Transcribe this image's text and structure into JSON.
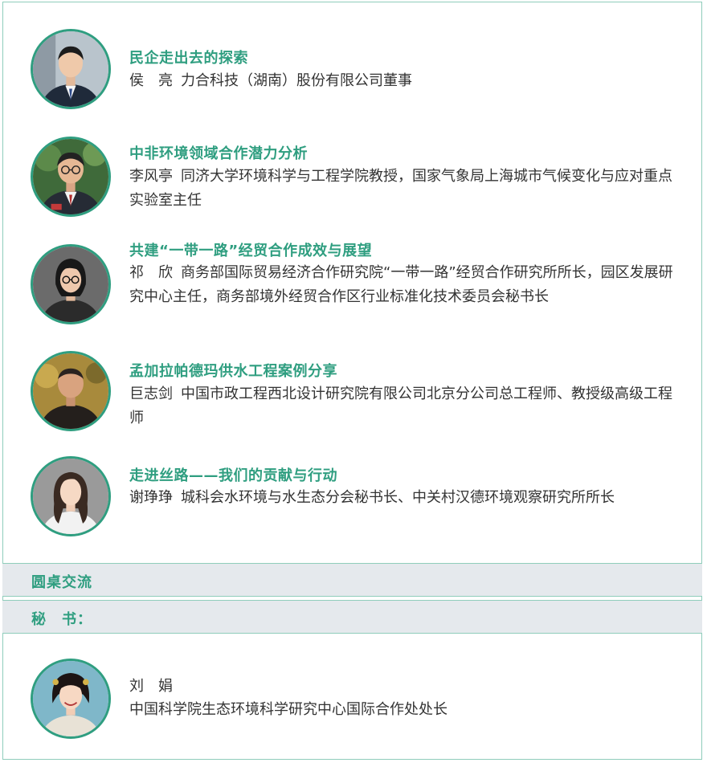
{
  "speakers": [
    {
      "topic": "民企走出去的探索",
      "name": "侯　亮",
      "title": "力合科技（湖南）股份有限公司董事",
      "avatar": "portrait-male-suit"
    },
    {
      "topic": "中非环境领域合作潜力分析",
      "name": "李风亭",
      "title": "同济大学环境科学与工程学院教授，国家气象局上海城市气候变化与应对重点实验室主任",
      "avatar": "portrait-male-glasses"
    },
    {
      "topic": "共建“一带一路”经贸合作成效与展望",
      "name": "祁　欣",
      "title": "商务部国际贸易经济合作研究院“一带一路”经贸合作研究所所长，园区发展研究中心主任，商务部境外经贸合作区行业标准化技术委员会秘书长",
      "avatar": "portrait-female-glasses"
    },
    {
      "topic": "孟加拉帕德玛供水工程案例分享",
      "name": "巨志剑",
      "title": "中国市政工程西北设计研究院有限公司北京分公司总工程师、教授级高级工程师",
      "avatar": "portrait-male-dark"
    },
    {
      "topic": "走进丝路——我们的贡献与行动",
      "name": "谢琤琤",
      "title": "城科会水环境与水生态分会秘书长、中关村汉德环境观察研究所所长",
      "avatar": "portrait-female-white"
    }
  ],
  "roundtable": {
    "label": "圆桌交流"
  },
  "secretary": {
    "label": "秘　书：",
    "name": "刘　娟",
    "title": "中国科学院生态环境科学研究中心国际合作处处长",
    "avatar": "portrait-female-smile"
  },
  "colors": {
    "accent": "#2f9e80",
    "band_bg": "#e5e9ed",
    "border": "#8fcdbb",
    "text": "#333333"
  }
}
